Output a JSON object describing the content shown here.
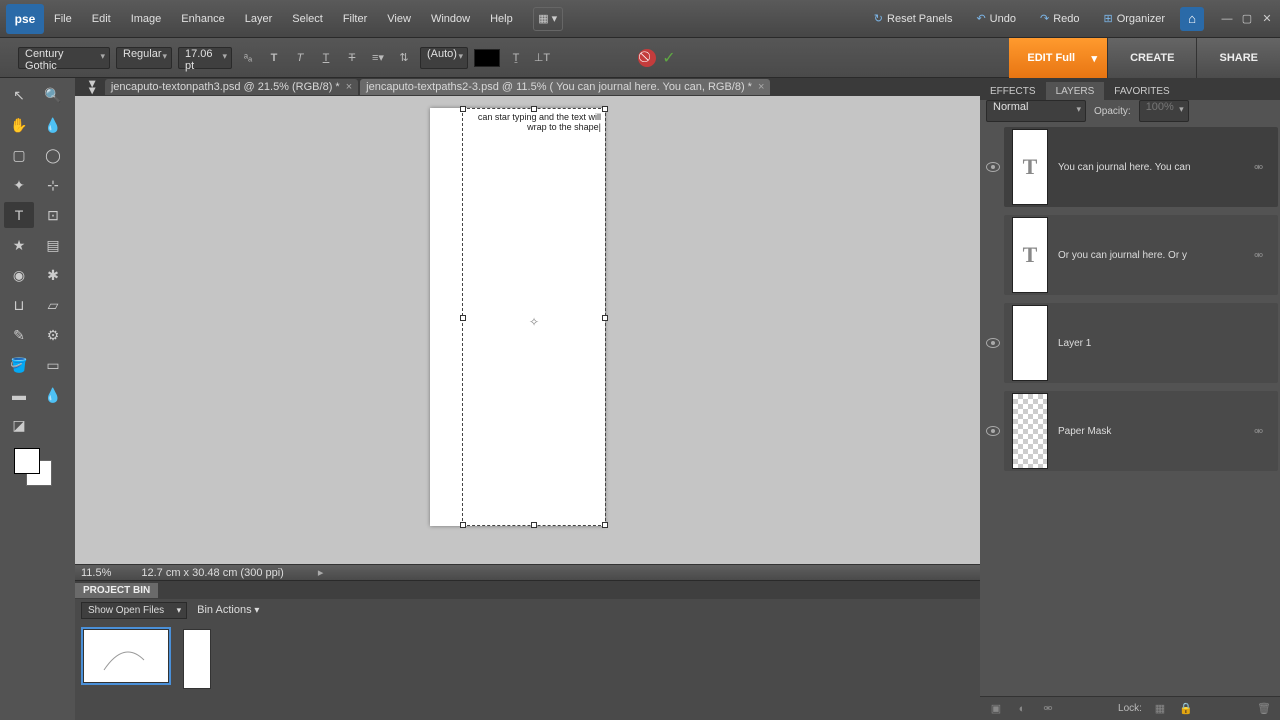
{
  "menu": {
    "items": [
      "File",
      "Edit",
      "Image",
      "Enhance",
      "Layer",
      "Select",
      "Filter",
      "View",
      "Window",
      "Help"
    ],
    "reset": "Reset Panels",
    "undo": "Undo",
    "redo": "Redo",
    "organizer": "Organizer"
  },
  "options": {
    "font": "Century Gothic",
    "style": "Regular",
    "size": "17.06 pt",
    "leading": "(Auto)"
  },
  "actionbar": {
    "edit": "EDIT Full",
    "create": "CREATE",
    "share": "SHARE"
  },
  "tabs": [
    {
      "label": "jencaputo-textonpath3.psd @ 21.5% (RGB/8) *"
    },
    {
      "label": "jencaputo-textpaths2-3.psd @ 11.5% ( You can journal here. You can, RGB/8) *"
    }
  ],
  "canvas": {
    "text": "can star typing and the text will wrap to the shape|"
  },
  "status": {
    "zoom": "11.5%",
    "dims": "12.7 cm x 30.48 cm (300 ppi)"
  },
  "projectbin": {
    "title": "PROJECT BIN",
    "filter": "Show Open Files",
    "actions": "Bin Actions"
  },
  "panels": {
    "tabs": [
      "EFFECTS",
      "LAYERS",
      "FAVORITES"
    ],
    "blend": "Normal",
    "opacity_label": "Opacity:",
    "opacity_val": "100%",
    "lock_label": "Lock:"
  },
  "layers": [
    {
      "name": "You can journal here. You can",
      "type": "T",
      "visible": true
    },
    {
      "name": "Or you can journal here.  Or y",
      "type": "T",
      "visible": false
    },
    {
      "name": "Layer 1",
      "type": "blank",
      "visible": true
    },
    {
      "name": "Paper Mask",
      "type": "trans",
      "visible": true
    }
  ]
}
